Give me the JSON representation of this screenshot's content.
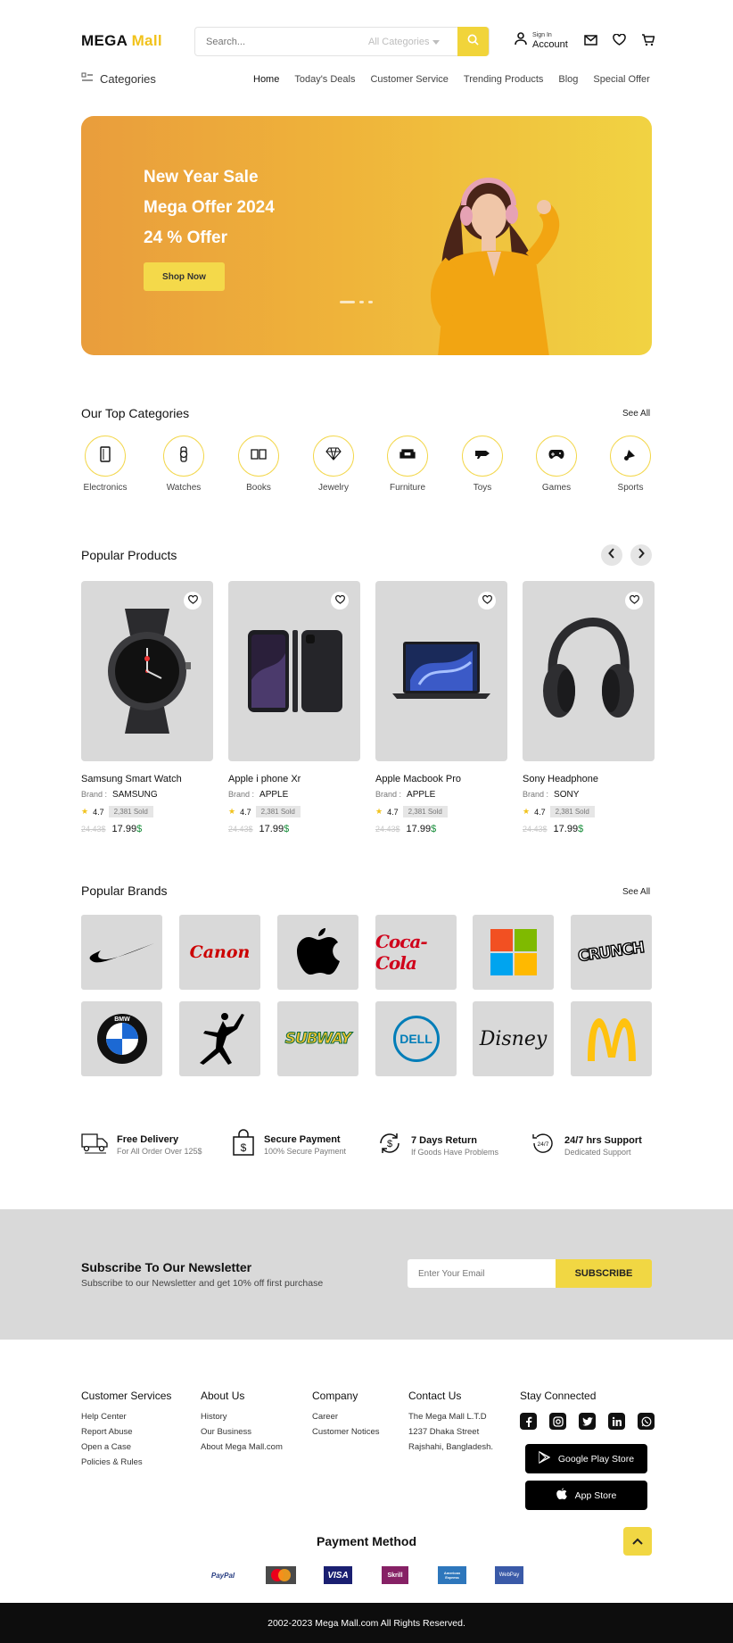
{
  "header": {
    "logo_part1": "MEGA",
    "logo_part2": " Mall",
    "search_placeholder": "Search...",
    "category_select": "All Categories",
    "sign_in_small": "Sign In",
    "account_label": "Account",
    "categories_button": "Categories",
    "nav": [
      "Home",
      "Today's Deals",
      "Customer Service",
      "Trending Products",
      "Blog",
      "Special Offer"
    ]
  },
  "hero": {
    "line1": "New Year Sale",
    "line2": "Mega Offer 2024",
    "line3": "24 % Offer",
    "cta": "Shop Now"
  },
  "top_categories": {
    "title": "Our Top Categories",
    "see_all": "See All",
    "items": [
      {
        "label": "Electronics",
        "icon": "smartphone-icon"
      },
      {
        "label": "Watches",
        "icon": "watch-icon"
      },
      {
        "label": "Books",
        "icon": "book-icon"
      },
      {
        "label": "Jewelry",
        "icon": "diamond-icon"
      },
      {
        "label": "Furniture",
        "icon": "sofa-icon"
      },
      {
        "label": "Toys",
        "icon": "toy-icon"
      },
      {
        "label": "Games",
        "icon": "gamepad-icon"
      },
      {
        "label": "Sports",
        "icon": "shuttlecock-icon"
      }
    ]
  },
  "popular_products": {
    "title": "Popular Products",
    "brand_prefix": "Brand :",
    "items": [
      {
        "name": "Samsung Smart Watch",
        "brand": "SAMSUNG",
        "rating": "4.7",
        "sold": "2,381 Sold",
        "old_price": "24.43$",
        "price": "17.99",
        "currency": "$",
        "image": "smartwatch"
      },
      {
        "name": "Apple i phone Xr",
        "brand": "APPLE",
        "rating": "4.7",
        "sold": "2,381 Sold",
        "old_price": "24.43$",
        "price": "17.99",
        "currency": "$",
        "image": "phone"
      },
      {
        "name": "Apple Macbook Pro",
        "brand": "APPLE",
        "rating": "4.7",
        "sold": "2,381 Sold",
        "old_price": "24.43$",
        "price": "17.99",
        "currency": "$",
        "image": "laptop"
      },
      {
        "name": "Sony Headphone",
        "brand": "SONY",
        "rating": "4.7",
        "sold": "2,381 Sold",
        "old_price": "24.43$",
        "price": "17.99",
        "currency": "$",
        "image": "headphone"
      }
    ]
  },
  "popular_brands": {
    "title": "Popular Brands",
    "see_all": "See All",
    "brands": [
      "Nike",
      "Canon",
      "Apple",
      "Coca-Cola",
      "Microsoft",
      "Crunch",
      "BMW",
      "Jordan",
      "Subway",
      "Dell",
      "Disney",
      "McDonald's"
    ],
    "canon_text": "Canon",
    "coke_text": "Coca-Cola",
    "crunch_text": "CRUNCH",
    "bmw_text": "BMW",
    "subway_text": "SUBWAY",
    "dell_text": "DELL",
    "disney_text": "Disney"
  },
  "features": [
    {
      "title": "Free Delivery",
      "sub": "For All Order Over 125$",
      "icon": "truck-icon"
    },
    {
      "title": "Secure Payment",
      "sub": "100% Secure Payment",
      "icon": "shopping-bag-dollar-icon"
    },
    {
      "title": "7 Days Return",
      "sub": "If Goods Have Problems",
      "icon": "return-dollar-icon"
    },
    {
      "title": "24/7 hrs Support",
      "sub": "Dedicated Support",
      "icon": "support-24-icon"
    }
  ],
  "newsletter": {
    "title": "Subscribe To Our Newsletter",
    "subtitle": "Subscribe to our Newsletter and get 10% off first purchase",
    "placeholder": "Enter Your Email",
    "button": "SUBSCRIBE"
  },
  "footer": {
    "columns": [
      {
        "heading": "Customer Services",
        "links": [
          "Help Center",
          "Report Abuse",
          "Open a Case",
          "Policies & Rules"
        ]
      },
      {
        "heading": "About Us",
        "links": [
          "History",
          "Our Business",
          "About Mega Mall.com"
        ]
      },
      {
        "heading": "Company",
        "links": [
          "Career",
          "Customer Notices"
        ]
      },
      {
        "heading": "Contact Us",
        "links": [
          "The Mega Mall L.T.D",
          "1237 Dhaka Street",
          "Rajshahi, Bangladesh."
        ]
      }
    ],
    "stay_connected": "Stay Connected",
    "social": [
      "facebook-icon",
      "instagram-icon",
      "twitter-icon",
      "linkedin-icon",
      "whatsapp-icon"
    ],
    "google_play": "Google Play Store",
    "app_store": "App Store",
    "payment_title": "Payment Method",
    "payments": [
      "PayPal",
      "MasterCard",
      "VISA",
      "Skrill",
      "American Express",
      "WebPay"
    ],
    "copyright": "2002-2023 Mega Mall.com All Rights Reserved."
  },
  "colors": {
    "accent": "#f1d743",
    "hero_start": "#e99d3c",
    "hero_end": "#f1d342",
    "tile": "#d9d9d9"
  }
}
